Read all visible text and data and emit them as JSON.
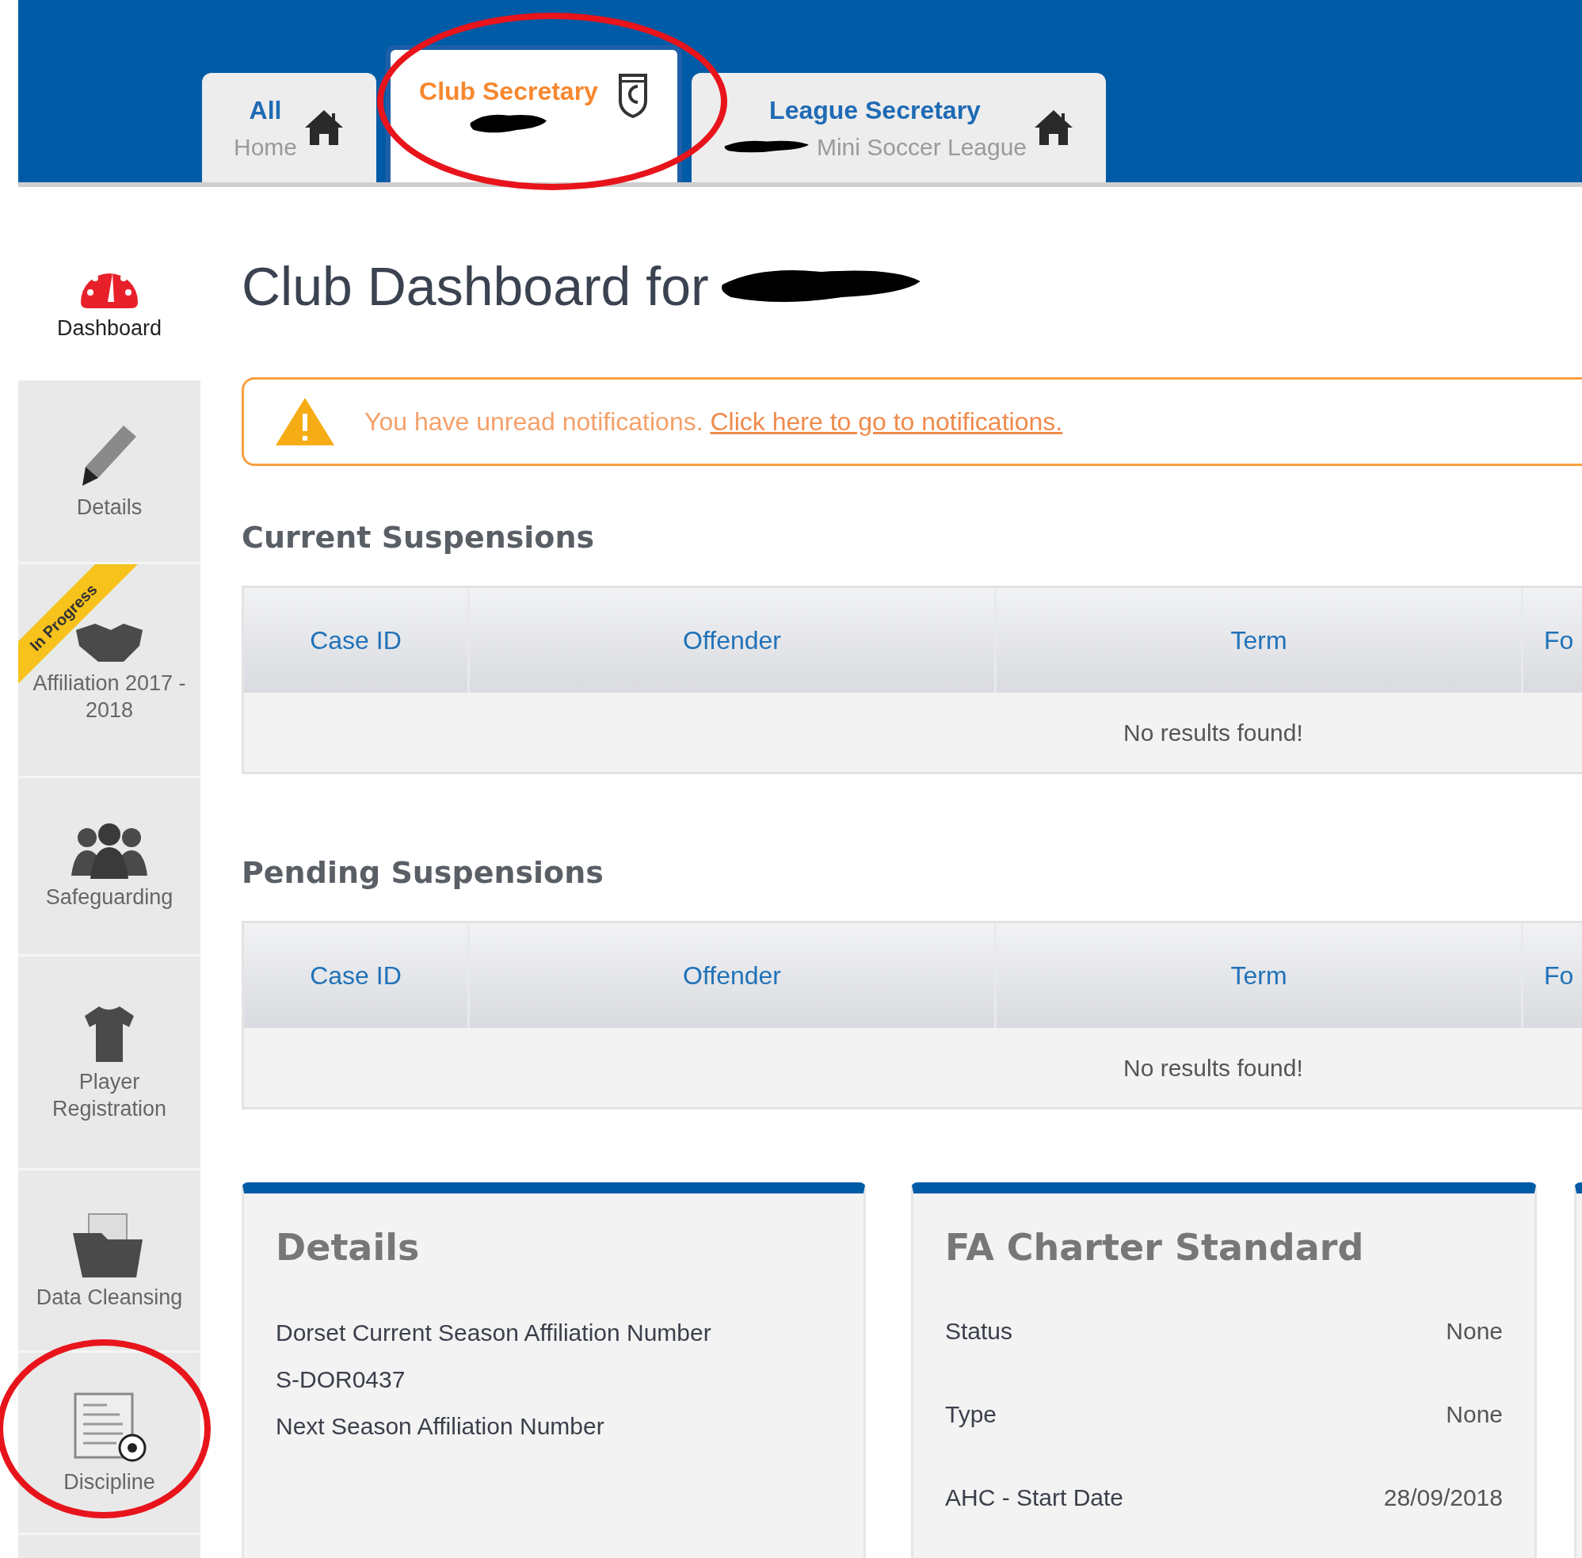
{
  "tabs": [
    {
      "title": "All",
      "subtitle": "Home",
      "kind": "home",
      "selected": false,
      "redacted": false
    },
    {
      "title": "Club Secretary",
      "kind": "crest",
      "selected": true,
      "redacted": true
    },
    {
      "title": "League Secretary",
      "subtitle": "Mini Soccer League",
      "kind": "home",
      "selected": false,
      "redacted": true
    }
  ],
  "sidebar": {
    "items": [
      {
        "label": "Dashboard",
        "kind": "gauge",
        "selected": true
      },
      {
        "label": "Details",
        "kind": "pencil",
        "selected": false
      },
      {
        "label": "Affiliation 2017 - 2018",
        "kind": "handshake",
        "selected": false,
        "ribbon": "In Progress"
      },
      {
        "label": "Safeguarding",
        "kind": "people",
        "selected": false
      },
      {
        "label": "Player Registration",
        "kind": "shirt",
        "selected": false
      },
      {
        "label": "Data Cleansing",
        "kind": "folder",
        "selected": false
      },
      {
        "label": "Discipline",
        "kind": "document",
        "selected": false
      }
    ]
  },
  "page_title": {
    "text": "Club Dashboard for",
    "redacted": true
  },
  "notification": {
    "message": "You have unread notifications.",
    "link": "Click here to go to notifications."
  },
  "sections": [
    {
      "title": "Current Suspensions",
      "columns": [
        "Case ID",
        "Offender",
        "Term",
        "Fo"
      ],
      "empty_message": "No results found!"
    },
    {
      "title": "Pending Suspensions",
      "columns": [
        "Case ID",
        "Offender",
        "Term",
        "Fo"
      ],
      "empty_message": "No results found!"
    }
  ],
  "cards": [
    {
      "kind": "text",
      "title": "Details",
      "lines": [
        "Dorset Current Season Affiliation Number",
        "S-DOR0437",
        "Next Season Affiliation Number"
      ]
    },
    {
      "kind": "pairs",
      "title": "FA Charter Standard",
      "rows": [
        {
          "label": "Status",
          "value": "None"
        },
        {
          "label": "Type",
          "value": "None"
        },
        {
          "label": "AHC - Start Date",
          "value": "28/09/2018"
        }
      ]
    },
    {
      "kind": "blank"
    }
  ]
}
